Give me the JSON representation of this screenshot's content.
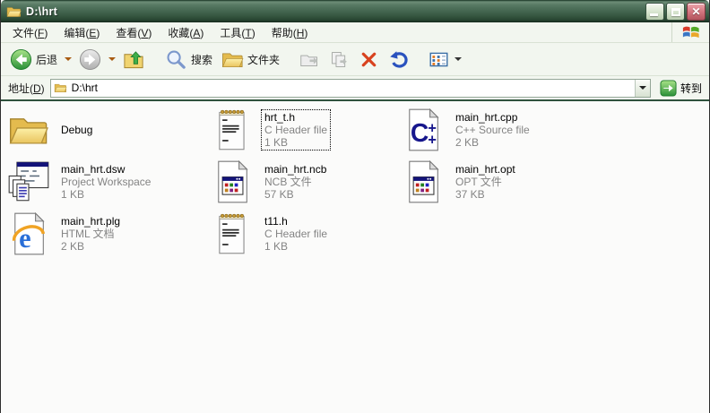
{
  "window": {
    "title": "D:\\hrt",
    "controls": {
      "minimize": "minimize-button",
      "restore": "restore-button",
      "close": "close-button"
    }
  },
  "menu": {
    "items": [
      {
        "label": "文件(F)"
      },
      {
        "label": "编辑(E)"
      },
      {
        "label": "查看(V)"
      },
      {
        "label": "收藏(A)"
      },
      {
        "label": "工具(T)"
      },
      {
        "label": "帮助(H)"
      }
    ]
  },
  "toolbar": {
    "back_label": "后退",
    "search_label": "搜索",
    "folders_label": "文件夹"
  },
  "address": {
    "label": "地址(D)",
    "value": "D:\\hrt",
    "go_label": "转到"
  },
  "files": [
    {
      "name": "Debug",
      "type": "",
      "size": "",
      "icon": "folder-icon"
    },
    {
      "name": "hrt_t.h",
      "type": "C Header file",
      "size": "1 KB",
      "icon": "text-file-icon",
      "focused": true
    },
    {
      "name": "main_hrt.cpp",
      "type": "C++ Source file",
      "size": "2 KB",
      "icon": "cpp-file-icon"
    },
    {
      "name": "main_hrt.dsw",
      "type": "Project Workspace",
      "size": "1 KB",
      "icon": "dsw-file-icon"
    },
    {
      "name": "main_hrt.ncb",
      "type": "NCB 文件",
      "size": "57 KB",
      "icon": "ncb-file-icon"
    },
    {
      "name": "main_hrt.opt",
      "type": "OPT 文件",
      "size": "37 KB",
      "icon": "opt-file-icon"
    },
    {
      "name": "main_hrt.plg",
      "type": "HTML 文档",
      "size": "2 KB",
      "icon": "ie-file-icon"
    },
    {
      "name": "t11.h",
      "type": "C Header file",
      "size": "1 KB",
      "icon": "text-file-icon"
    }
  ],
  "colors": {
    "titlebar_green": "#456751",
    "chrome_bg": "#f2f6ef",
    "accent_green": "#2f9e3f",
    "close_red": "#c05f68",
    "meta_gray": "#848484"
  }
}
